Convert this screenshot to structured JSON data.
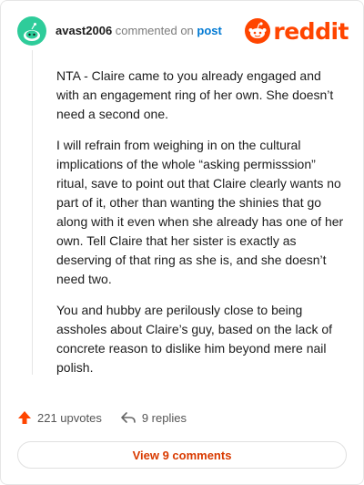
{
  "comment": {
    "username": "avast2006",
    "commented_on": "commented on",
    "post_link": "post",
    "paragraphs": [
      "NTA - Claire came to you already engaged and with an engagement ring of her own. She doesn’t need a second one.",
      "I will refrain from weighing in on the cultural implications of the whole “asking permisssion” ritual, save to point out that Claire clearly wants no part of it, other than wanting the shinies that go along with it even when she already has one of her own. Tell Claire that her sister is exactly as deserving of that ring as she is, and she doesn’t need two.",
      "You and hubby are perilously close to being assholes about Claire’s guy, based on the lack of concrete reason to dislike him beyond mere nail polish."
    ],
    "upvotes": "221 upvotes",
    "replies": "9 replies",
    "view_comments": "View 9 comments"
  },
  "branding": {
    "logo_text": "reddit"
  },
  "colors": {
    "accent": "#ff4500",
    "link": "#0079d3",
    "avatar": "#2ecc9a",
    "button_text": "#d93a00"
  },
  "icons": [
    "avatar-icon",
    "reddit-logo-icon",
    "upvote-arrow-icon",
    "reply-arrow-icon"
  ]
}
